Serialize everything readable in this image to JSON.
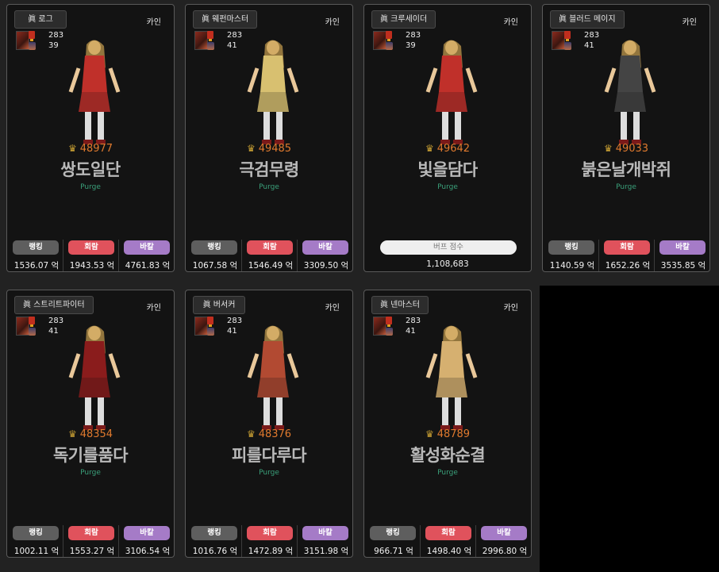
{
  "unit_suffix": "억",
  "cards": [
    {
      "job": "眞 로그",
      "server": "카인",
      "fame": "283",
      "char_level": "39",
      "score": "48977",
      "name": "쌍도일단",
      "guild": "Purge",
      "type": "damage",
      "labels": [
        "랭킹",
        "회람",
        "바칼"
      ],
      "values": [
        "1536.07",
        "1943.53",
        "4761.83"
      ],
      "figure_color": "#c0302a"
    },
    {
      "job": "眞 웨펀마스터",
      "server": "카인",
      "fame": "283",
      "char_level": "41",
      "score": "49485",
      "name": "극검무령",
      "guild": "Purge",
      "type": "damage",
      "labels": [
        "랭킹",
        "회람",
        "바칼"
      ],
      "values": [
        "1067.58",
        "1546.49",
        "3309.50"
      ],
      "figure_color": "#d8c070"
    },
    {
      "job": "眞 크루세이더",
      "server": "카인",
      "fame": "283",
      "char_level": "39",
      "score": "49642",
      "name": "빛을담다",
      "guild": "Purge",
      "type": "buff",
      "buff_label": "버프 점수",
      "buff_value": "1,108,683",
      "figure_color": "#c0302a"
    },
    {
      "job": "眞 블러드 메이지",
      "server": "카인",
      "fame": "283",
      "char_level": "41",
      "score": "49033",
      "name": "붉은날개박쥐",
      "guild": "Purge",
      "type": "damage",
      "labels": [
        "랭킹",
        "회람",
        "바칼"
      ],
      "values": [
        "1140.59",
        "1652.26",
        "3535.85"
      ],
      "figure_color": "#444"
    },
    {
      "job": "眞 스트리트파이터",
      "server": "카인",
      "fame": "283",
      "char_level": "41",
      "score": "48354",
      "name": "독기를품다",
      "guild": "Purge",
      "type": "damage",
      "labels": [
        "랭킹",
        "회람",
        "바칼"
      ],
      "values": [
        "1002.11",
        "1553.27",
        "3106.54"
      ],
      "figure_color": "#8a1c1c"
    },
    {
      "job": "眞 버서커",
      "server": "카인",
      "fame": "283",
      "char_level": "41",
      "score": "48376",
      "name": "피를다루다",
      "guild": "Purge",
      "type": "damage",
      "labels": [
        "랭킹",
        "회람",
        "바칼"
      ],
      "values": [
        "1016.76",
        "1472.89",
        "3151.98"
      ],
      "figure_color": "#b24a32"
    },
    {
      "job": "眞 넨마스터",
      "server": "카인",
      "fame": "283",
      "char_level": "41",
      "score": "48789",
      "name": "활성화순결",
      "guild": "Purge",
      "type": "damage",
      "labels": [
        "랭킹",
        "회람",
        "바칼"
      ],
      "values": [
        "966.71",
        "1498.40",
        "2996.80"
      ],
      "figure_color": "#d6b070"
    }
  ]
}
